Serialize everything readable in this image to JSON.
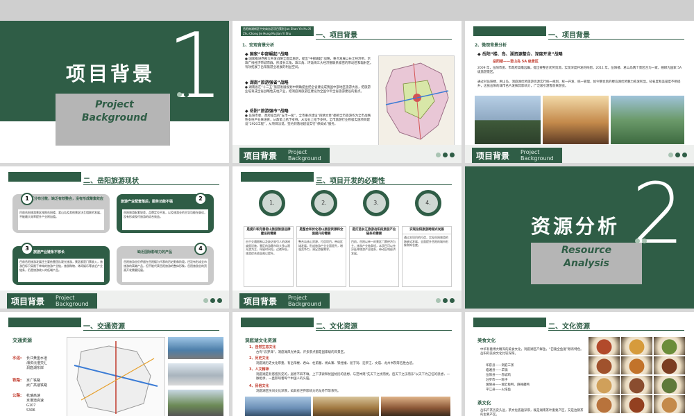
{
  "slide1": {
    "title": "项目背景",
    "subtitle_en": "Project\nBackground",
    "number": "1"
  },
  "slide2": {
    "header_strip": "岳阳南湖新区中央商务区项目策划 Jun Shan Yin Hu Xi Zhu Chong Jie Hung Mu Jian Yi Shu",
    "section": "一、项目背景",
    "sub": "1、宏观背景分析",
    "p1_title": "◆ 国家“中部崛起”战略",
    "p1_body": "● 国家推进西部大开发战略全面实施后，提出“中部崛起”战略，重点发展以长江经济带、京珠广线经济带城市群，形成长三角、珠三角、环渤海三大经济圈联系紧密的带动区和辐射区。有效拓展了岳阳旅游业发展的利益空间。",
    "p2_title": "◆ 湖南“旅游强省”战略",
    "p2_body": "● 湖南省在“十二五”旅游发展规划中明确提出把全省建设成我国中部地区旅游大省，把旅游业培育成全省战略性支柱产业，把洞庭湖旅游区建设为全国今年全省旅游建设的重点。",
    "p3_title": "◆ 岳阳“旅游强市”战略",
    "p3_body": "● 岳阳市委、政府提出的“五市一极”，全市重点建设“四精文章”都把全市旅游作为全市战略性支柱产业来培育，从政策上给予支持。从设业上给予支持。全市旅游行业积极实施项目建设“2920工程”，从项目法说，签约到落地建设实行“保姆式”服务。"
  },
  "slide3": {
    "section": "一、项目背景",
    "sub": "2、微观背景分析",
    "p1_title": "◆ 岳阳“楼、岛、湖资源整合、深度开发”战略",
    "p1_red": "岳阳楼——君山岛 5A 级景区",
    "p1_body": "2009 年，岳阳市委、市政府高瞻远瞩，提出要整合优势资源，实现深度开发的构想。2011 年，岳阳楼、君山岛两个景区合为一家，捆绑为国家 5A 级旅游景区。",
    "p2_body": "通过对岳阳楼、君山岛、洞庭湖优势旅游资源实行统一规划、统一开发、统一管理，如今整合后的楼岛湖优势魅力愈发彰显。知名度和美誉度不断提升，这张岳阳的城市名片发挥其影响力，广泛吸引游客前来游览。"
  },
  "footer": {
    "cn": "项目背景",
    "en": "Project\nBackground"
  },
  "slide4": {
    "section": "二、岳阳旅游现状",
    "items": [
      {
        "num": "1",
        "title": "景区分布分散，缺乏有效整合，没有形成聚集效应",
        "body": "目前岳阳旅游景区按照岳阳楼、君山岛及其他景区块互相联的发展，不能最大效率提升产业附加值。"
      },
      {
        "num": "2",
        "title": "旅游产业配套落后，服务功能不强",
        "body": "岳阳旅游配套较差，品牌定位不准，以及旅游业的主导功能在弱化，没有形成现代旅游的综合效益。"
      },
      {
        "num": "3",
        "title": "旅游产业链条不够长",
        "body": "目前岳阳旅游发展还主要依靠团队观光旅游，景区都是门票收入，旅游目标只局限于单纯的旅游产业链，旅游购物、休闲娱乐等缺乏产业链条，仍是旅游收入的低端产品。"
      },
      {
        "num": "4",
        "title": "缺乏国际影响力的产品",
        "body": "岳阳旅游业仍停留在岳阳楼为代表的历史影像阶段，还没有形成全市旅游的高端产品，但不能代表岳阳旅游的整体形象，岳阳旅游业的资源开发需要拓展。"
      }
    ]
  },
  "slide5": {
    "section": "三、项目开发的必要性",
    "circles": [
      "1.",
      "2.",
      "3.",
      "4."
    ],
    "cards": [
      {
        "title": "是提升和完善君山旅游旅游品牌建设的需要",
        "body": "由于交通限制以及缺乏吸引人的休闲度假设施，景区的游客市场大多以观光游为主，停留时间短，过夜率低，旅游综合收益难以提升。"
      },
      {
        "title": "是整合和优化君山旅游资源和全面提升的需要",
        "body": "整合岛核心资源，打造项目，带动区域发展，形成旅游产业全面提升，增强竞争力，满足游客需求。"
      },
      {
        "title": "是打造长江旅游岳阳段旅游产业链条的需要",
        "body": "目前，岳阳以单一的景区门票经济为主，旅游产业链条短，本项目可以充分延伸旅游产业链条，带动区域经济发展。"
      },
      {
        "title": "实现岳阳旅游跨越式发展",
        "body": "通过本项目的打造，实现岳阳旅游的跨越式发展，全面提升岳阳的城市形象和知名度。"
      }
    ]
  },
  "slide6": {
    "title": "资源分析",
    "subtitle_en": "Resource\nAnalysis",
    "number": "2"
  },
  "slide7": {
    "section": "一、交通资源",
    "label": "交通资源",
    "water_k": "水运:",
    "water_v": "长江黄金水道\n湘资沅澧交汇\n洞庭湖东岸",
    "rail_k": "铁路:",
    "rail_v": "京广铁路\n武广高速铁路",
    "road_k": "公路:",
    "road_v": "杭瑞高速\n京港澳高速\nG107\nS306"
  },
  "slide8": {
    "section": "二、文化资源",
    "label": "洞庭湖文化资源",
    "items": [
      {
        "t": "1、自然生态文化",
        "b": "古有“云梦泽”，洞庭湖风光秀美，许多景点都是国家级的风景区。"
      },
      {
        "t": "2、历史文化",
        "b": "洞庭湖历史文化厚重，有岳阳楼、君山、杜甫墓、杨幺寨、铁经幢、屈子祠、汨罗江、文庙、龙州书院等名胜古迹。"
      },
      {
        "t": "3、人文精神",
        "b": "洞庭湖是有悠悠历史的，居原不四不填，上下求索和忧国忧民的思想，与范仲淹“先天下之忧而忧，后天下之乐而乐”以天下为己任的思想，一脉相承，一直影响着每个中国人的头脑。"
      },
      {
        "t": "4、民俗文化",
        "b": "洞庭湖区民间文化深厚，如具有世界影响力的龙舟节等系列。"
      }
    ]
  },
  "slide9": {
    "section": "二、文化资源",
    "food_title": "美食文化",
    "food_body": "中华有着博大精深的美食文化，洞庭湖区产鲜鱼，“巴陵全鱼宴”颇有特色。岳阳的美食文化比较深厚。",
    "dishes": [
      "华容县——洞庭三蒸",
      "临湘县——羊锅",
      "岳阳县——赤城鸡",
      "汨罗市——粽子",
      "湘阴县——湘云板鸭、麻辣藕鸭",
      "平江县——火焙鱼"
    ],
    "tea_title": "茶文化",
    "tea_body": "岳阳产茶历史久远，茶文化底蕴深厚，既是湖南茶叶重要产区，又是边销茶的主要产区。"
  }
}
